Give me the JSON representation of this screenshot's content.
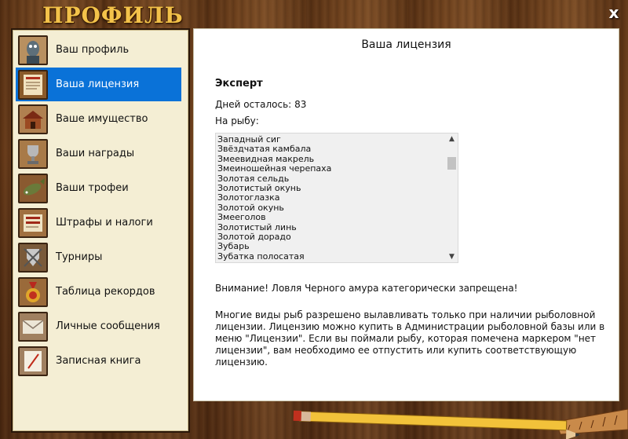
{
  "window": {
    "title": "ПРОФИЛЬ",
    "close_label": "x"
  },
  "sidebar": {
    "items": [
      {
        "label": "Ваш профиль",
        "icon": "fisherman-icon",
        "active": false
      },
      {
        "label": "Ваша лицензия",
        "icon": "license-icon",
        "active": true
      },
      {
        "label": "Ваше имущество",
        "icon": "property-icon",
        "active": false
      },
      {
        "label": "Ваши награды",
        "icon": "trophy-cup-icon",
        "active": false
      },
      {
        "label": "Ваши трофеи",
        "icon": "fish-trophy-icon",
        "active": false
      },
      {
        "label": "Штрафы и налоги",
        "icon": "fines-icon",
        "active": false
      },
      {
        "label": "Турниры",
        "icon": "tournament-icon",
        "active": false
      },
      {
        "label": "Таблица рекордов",
        "icon": "medal-icon",
        "active": false
      },
      {
        "label": "Личные сообщения",
        "icon": "envelope-icon",
        "active": false
      },
      {
        "label": "Записная книга",
        "icon": "notebook-icon",
        "active": false
      }
    ]
  },
  "main": {
    "title": "Ваша лицензия",
    "grade": "Эксперт",
    "days_label": "Дней осталось:",
    "days_value": "83",
    "fish_label": "На рыбу:",
    "fish_list": [
      "Западный сиг",
      "Звёздчатая камбала",
      "Змеевидная макрель",
      "Змеиношейная черепаха",
      "Золотая сельдь",
      "Золотистый окунь",
      "Золотоглазка",
      "Золотой окунь",
      "Змееголов",
      "Золотистый линь",
      "Золотой дорадо",
      "Зубарь",
      "Зубатка полосатая"
    ],
    "warning": "Внимание! Ловля Черного амура категорически запрещена!",
    "info": "Многие виды рыб разрешено вылавливать только при наличии рыболовной лицензии. Лицензию можно купить в Администрации рыболовной базы или в меню \"Лицензии\". Если вы поймали рыбу, которая помечена маркером \"нет лицензии\", вам необходимо ее отпустить или купить соответствующую лицензию."
  },
  "colors": {
    "active_item": "#0a72d8",
    "title_gold": "#f3c24a",
    "sidebar_bg": "#f4eed4"
  }
}
